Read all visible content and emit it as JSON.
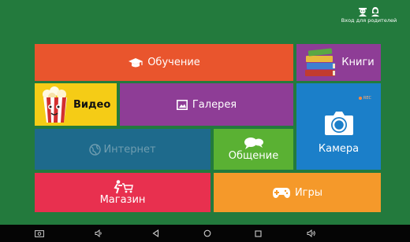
{
  "header": {
    "parent_login_label": "Вход для родителей"
  },
  "tiles": {
    "learning": "Обучение",
    "books": "Книги",
    "video": "Видео",
    "gallery": "Галерея",
    "camera": "Камера",
    "camera_rec": "REC",
    "internet": "Интернет",
    "chat": "Общение",
    "shop": "Магазин",
    "games": "Игры"
  },
  "colors": {
    "background": "#237a3d",
    "learning": "#e9552d",
    "books": "#8e3d96",
    "video": "#f5cc16",
    "gallery": "#8e3d96",
    "camera": "#1b7fc9",
    "internet": "#1e6a8c",
    "chat": "#5ab133",
    "shop": "#e8304f",
    "games": "#f5992a"
  },
  "navbar": {
    "icons": [
      "screenshot-icon",
      "volume-down-icon",
      "back-icon",
      "home-icon",
      "recents-icon",
      "volume-up-icon"
    ]
  }
}
